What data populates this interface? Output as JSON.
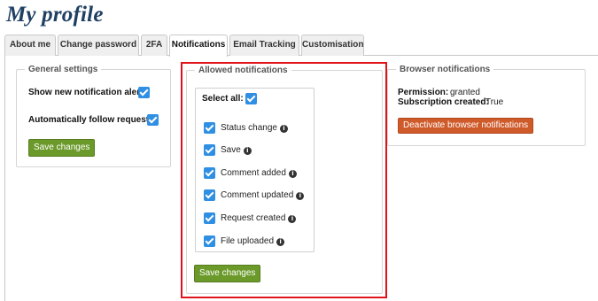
{
  "page": {
    "title": "My profile"
  },
  "tabs": [
    {
      "label": "About me"
    },
    {
      "label": "Change password"
    },
    {
      "label": "2FA"
    },
    {
      "label": "Notifications"
    },
    {
      "label": "Email Tracking"
    },
    {
      "label": "Customisation"
    }
  ],
  "active_tab": "Notifications",
  "general_settings": {
    "legend": "General settings",
    "show_alert_label": "Show new notification alert:",
    "show_alert_checked": true,
    "auto_follow_label": "Automatically follow requests:",
    "auto_follow_checked": true,
    "save_label": "Save changes"
  },
  "allowed_notifications": {
    "legend": "Allowed notifications",
    "select_all_label": "Select all:",
    "select_all_checked": true,
    "items": [
      {
        "label": "Status change",
        "checked": true,
        "icon": "info-icon"
      },
      {
        "label": "Save",
        "checked": true,
        "icon": "info-icon"
      },
      {
        "label": "Comment added",
        "checked": true,
        "icon": "info-icon"
      },
      {
        "label": "Comment updated",
        "checked": true,
        "icon": "info-icon"
      },
      {
        "label": "Request created",
        "checked": true,
        "icon": "info-icon"
      },
      {
        "label": "File uploaded",
        "checked": true,
        "icon": "info-icon"
      }
    ],
    "save_label": "Save changes"
  },
  "browser_notifications": {
    "legend": "Browser notifications",
    "permission_label": "Permission:",
    "permission_value": "granted",
    "subscription_label": "Subscription created:",
    "subscription_value": "True",
    "deactivate_label": "Deactivate browser notifications"
  },
  "colors": {
    "title": "#1f3f63",
    "checkbox": "#2f8fe3",
    "save_button": "#6b9a2a",
    "deactivate_button": "#cf5a2a",
    "highlight": "#e0131b"
  }
}
